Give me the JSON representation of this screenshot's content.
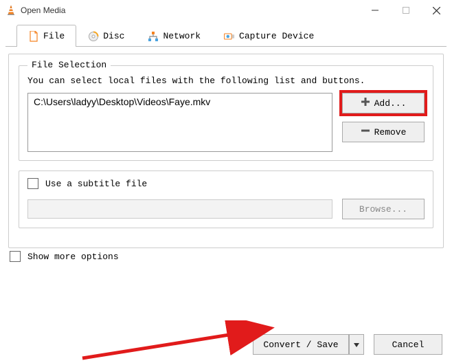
{
  "window": {
    "title": "Open Media"
  },
  "tabs": {
    "file": "File",
    "disc": "Disc",
    "network": "Network",
    "capture": "Capture Device"
  },
  "file_selection": {
    "legend": "File Selection",
    "hint": "You can select local files with the following list and buttons.",
    "files": [
      "C:\\Users\\ladyy\\Desktop\\Videos\\Faye.mkv"
    ],
    "add_button": "Add...",
    "remove_button": "Remove"
  },
  "subtitle": {
    "checkbox_label": "Use a subtitle file",
    "browse_button": "Browse..."
  },
  "footer": {
    "show_more": "Show more options",
    "convert_save": "Convert / Save",
    "cancel": "Cancel"
  }
}
